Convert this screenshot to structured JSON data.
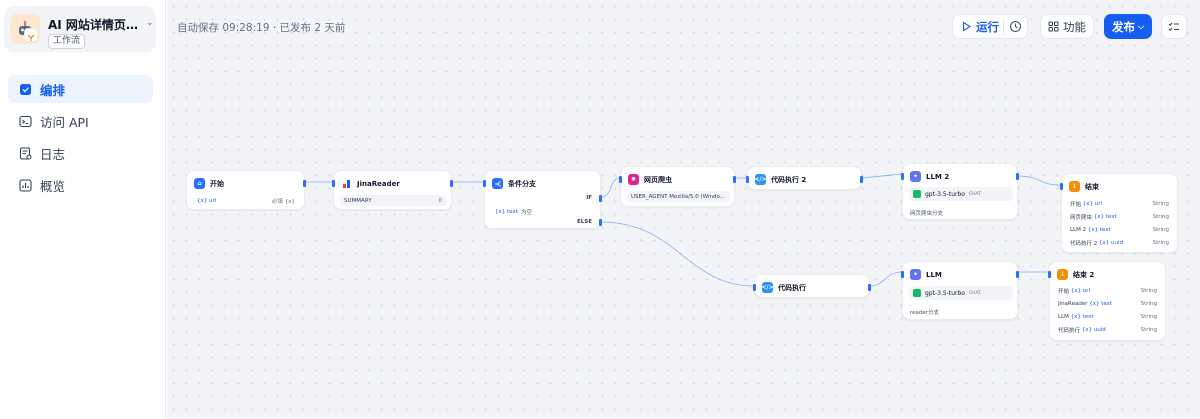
{
  "app": {
    "name": "AI 网站详情页面...",
    "tag": "工作流"
  },
  "nav": {
    "items": [
      {
        "label": "编排",
        "icon": "workflow-icon",
        "active": true
      },
      {
        "label": "访问 API",
        "icon": "terminal-icon",
        "active": false
      },
      {
        "label": "日志",
        "icon": "log-icon",
        "active": false
      },
      {
        "label": "概览",
        "icon": "chart-icon",
        "active": false
      }
    ]
  },
  "header": {
    "autosave": "自动保存 09:28:19 · 已发布 2 天前",
    "run_label": "运行",
    "feature_label": "功能",
    "publish_label": "发布"
  },
  "colors": {
    "accent": "#155eef",
    "start": "#2970ff",
    "branch": "#2970ff",
    "crawler": "#dd2590",
    "code": "#2e90fa",
    "llm": "#6172f3",
    "end": "#f79009",
    "model": "#12b76a"
  },
  "nodes": {
    "start": {
      "title": "开始",
      "var": "{x} url",
      "required": "必填 {x}"
    },
    "jina": {
      "title": "JinaReader",
      "summary": "SUMMARY",
      "count": "0"
    },
    "branch": {
      "title": "条件分支",
      "if": "IF",
      "cond_var": "{x} text",
      "cond_op": "为空",
      "else": "ELSE"
    },
    "crawler": {
      "title": "网页爬虫",
      "agent": "USER_AGENT Mozilla/5.0 (Windo..."
    },
    "code2": {
      "title": "代码执行 2"
    },
    "llm2": {
      "title": "LLM 2",
      "model": "gpt-3.5-turbo",
      "mode": "CHAT",
      "desc": "网页爬虫分支"
    },
    "end1": {
      "title": "结束",
      "outputs": [
        {
          "src": "开始",
          "var": "{x} url",
          "type": "String"
        },
        {
          "src": "网页爬虫",
          "var": "{x} text",
          "type": "String"
        },
        {
          "src": "LLM 2",
          "var": "{x} text",
          "type": "String"
        },
        {
          "src": "代码执行 2",
          "var": "{x} uuid",
          "type": "String"
        }
      ]
    },
    "code1": {
      "title": "代码执行"
    },
    "llm1": {
      "title": "LLM",
      "model": "gpt-3.5-turbo",
      "mode": "CHAT",
      "desc": "reader分支"
    },
    "end2": {
      "title": "结束 2",
      "outputs": [
        {
          "src": "开始",
          "var": "{x} url",
          "type": "String"
        },
        {
          "src": "JinaReader",
          "var": "{x} text",
          "type": "String"
        },
        {
          "src": "LLM",
          "var": "{x} text",
          "type": "String"
        },
        {
          "src": "代码执行",
          "var": "{x} uuid",
          "type": "String"
        }
      ]
    }
  }
}
